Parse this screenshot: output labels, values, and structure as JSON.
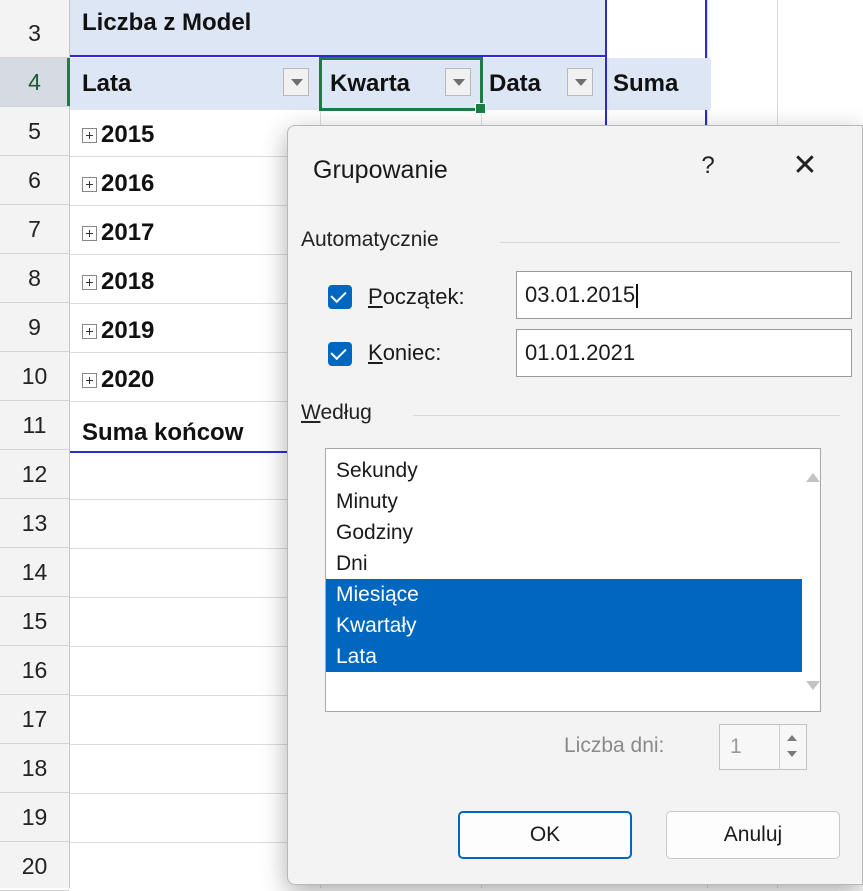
{
  "sheet": {
    "row_numbers": [
      "3",
      "4",
      "5",
      "6",
      "7",
      "8",
      "9",
      "10",
      "11",
      "12",
      "13",
      "14",
      "15",
      "16",
      "17",
      "18",
      "19",
      "20"
    ],
    "pivot_title": "Liczba z Model",
    "headers": {
      "lata": "Lata",
      "kwartal": "Kwarta",
      "data": "Data",
      "suma": "Suma"
    },
    "years": [
      "2015",
      "2016",
      "2017",
      "2018",
      "2019",
      "2020"
    ],
    "grand_total": "Suma końcow"
  },
  "dialog": {
    "title": "Grupowanie",
    "help": "?",
    "close": "✕",
    "auto_group": "Automatycznie",
    "start": {
      "label_first": "P",
      "label_rest": "oczątek:",
      "value": "03.01.2015",
      "checked": true
    },
    "end": {
      "label_first": "K",
      "label_rest": "oniec:",
      "value": "01.01.2021",
      "checked": true
    },
    "by_group": {
      "label_first": "W",
      "label_rest": "edług"
    },
    "options": [
      {
        "label": "Sekundy",
        "selected": false
      },
      {
        "label": "Minuty",
        "selected": false
      },
      {
        "label": "Godziny",
        "selected": false
      },
      {
        "label": "Dni",
        "selected": false
      },
      {
        "label": "Miesiące",
        "selected": true
      },
      {
        "label": "Kwartały",
        "selected": true
      },
      {
        "label": "Lata",
        "selected": true
      }
    ],
    "days_label": "Liczba dni:",
    "days_value": "1",
    "ok": "OK",
    "cancel": "Anuluj"
  },
  "colors": {
    "accent": "#0067c0",
    "selection_green": "#1d7b45",
    "pivot_header": "#dde6f4",
    "pivot_border": "#2b2bd0"
  }
}
